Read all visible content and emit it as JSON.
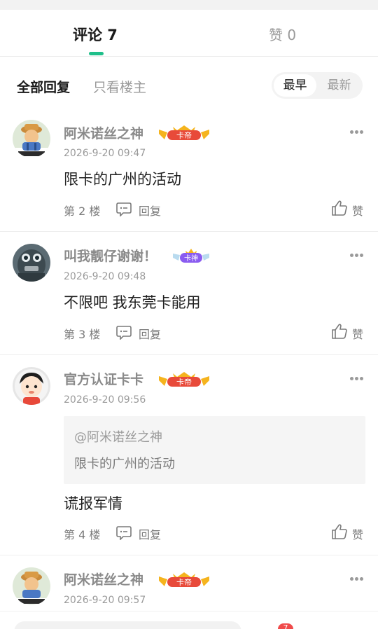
{
  "tabs": {
    "comments_label": "评论 7",
    "likes_label": "赞 0"
  },
  "filters": {
    "all": "全部回复",
    "owner_only": "只看楼主",
    "sort_earliest": "最早",
    "sort_latest": "最新"
  },
  "comments": [
    {
      "username": "阿米诺丝之神",
      "badge": "卡帝",
      "timestamp": "2026-9-20 09:47",
      "content": "限卡的广州的活动",
      "floor": "第 2 楼",
      "reply_label": "回复",
      "like_label": "赞"
    },
    {
      "username": "叫我靓仔谢谢！",
      "badge": "卡神",
      "timestamp": "2026-9-20 09:48",
      "content": "不限吧 我东莞卡能用",
      "floor": "第 3 楼",
      "reply_label": "回复",
      "like_label": "赞"
    },
    {
      "username": "官方认证卡卡",
      "badge": "卡帝",
      "timestamp": "2026-9-20 09:56",
      "quote": {
        "user": "@阿米诺丝之神",
        "text": "限卡的广州的活动"
      },
      "content": "谎报军情",
      "floor": "第 4 楼",
      "reply_label": "回复",
      "like_label": "赞"
    },
    {
      "username": "阿米诺丝之神",
      "badge": "卡帝",
      "timestamp": "2026-9-20 09:57"
    }
  ],
  "bottom": {
    "badge_count": "7"
  },
  "colors": {
    "accent": "#1fbf8a",
    "badge_red": "#e84a3a",
    "badge_gold": "#f5b41e",
    "badge_purple": "#8a5cf0"
  }
}
